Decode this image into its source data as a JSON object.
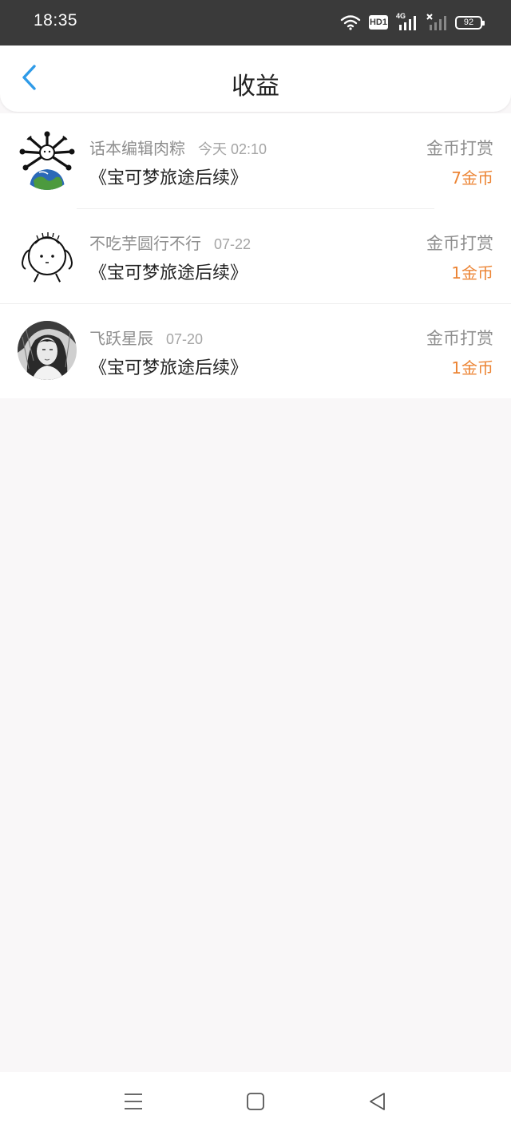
{
  "status_bar": {
    "time": "18:35",
    "hd_label": "HD1",
    "network_label": "4G",
    "battery_level": "92",
    "icons": [
      "wifi-icon",
      "hd-icon",
      "signal-4g-icon",
      "signal-no-service-icon",
      "battery-icon"
    ]
  },
  "header": {
    "title": "收益",
    "back_icon": "chevron-left-icon",
    "accent_color": "#2f9be8"
  },
  "list": [
    {
      "username": "话本编辑肉粽",
      "date": "今天 02:10",
      "book_title": "《宝可梦旅途后续》",
      "reward_type": "金币打赏",
      "reward_amount": "7金币"
    },
    {
      "username": "不吃芋圆行不行",
      "date": "07-22",
      "book_title": "《宝可梦旅途后续》",
      "reward_type": "金币打赏",
      "reward_amount": "1金币"
    },
    {
      "username": "飞跃星辰",
      "date": "07-20",
      "book_title": "《宝可梦旅途后续》",
      "reward_type": "金币打赏",
      "reward_amount": "1金币"
    }
  ],
  "colors": {
    "amount": "#ec8434",
    "secondary_text": "#8e8e8e",
    "background": "#f9f7f8"
  },
  "nav_bar": {
    "icons": [
      "menu-icon",
      "home-square-icon",
      "back-triangle-icon"
    ]
  }
}
